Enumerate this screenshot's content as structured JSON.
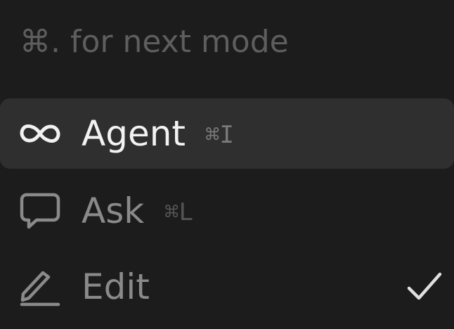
{
  "hint": "⌘. for next mode",
  "items": [
    {
      "label": "Agent",
      "shortcut": "⌘I",
      "icon": "infinity-icon",
      "highlighted": true,
      "checked": false
    },
    {
      "label": "Ask",
      "shortcut": "⌘L",
      "icon": "chat-bubble-icon",
      "highlighted": false,
      "checked": false
    },
    {
      "label": "Edit",
      "shortcut": "",
      "icon": "pencil-icon",
      "highlighted": false,
      "checked": true
    }
  ],
  "colors": {
    "background": "#1c1c1c",
    "highlight": "#2f2f2f",
    "active_text": "#f2f2f2",
    "inactive_text": "#8a8a8a",
    "hint_text": "#5e5e5e"
  }
}
